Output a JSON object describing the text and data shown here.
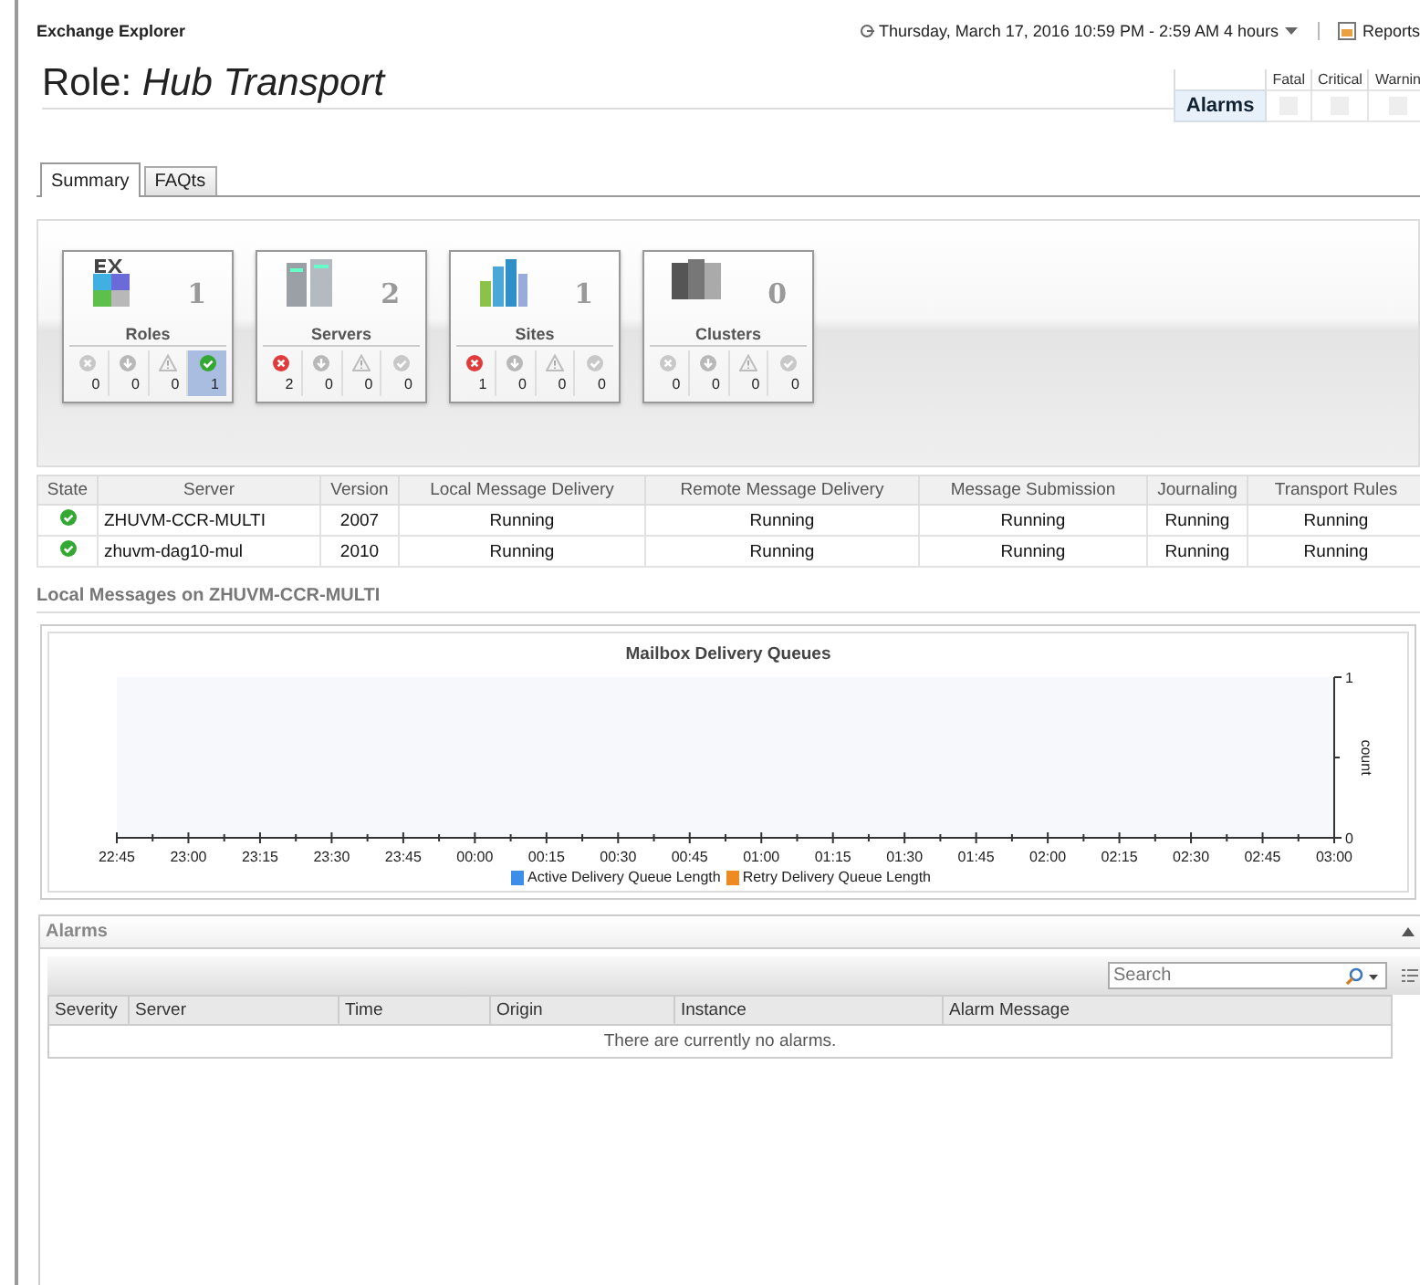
{
  "header": {
    "app_title": "Exchange Explorer",
    "time_range": "Thursday, March 17, 2016 10:59 PM - 2:59 AM 4 hours",
    "reports": "Reports"
  },
  "page_title": {
    "prefix": "Role:",
    "name": "Hub Transport"
  },
  "alarm_summary": {
    "row_label": "Alarms",
    "columns": [
      "Fatal",
      "Critical",
      "Warnin"
    ]
  },
  "tabs": [
    {
      "label": "Summary",
      "selected": true
    },
    {
      "label": "FAQts",
      "selected": false
    }
  ],
  "summary_cards": [
    {
      "kind": "roles",
      "label": "Roles",
      "count": "1",
      "statuses": [
        {
          "kind": "fatal",
          "count": "0",
          "active": false,
          "selected": false
        },
        {
          "kind": "critical",
          "count": "0",
          "active": false,
          "selected": false
        },
        {
          "kind": "warning",
          "count": "0",
          "active": false,
          "selected": false
        },
        {
          "kind": "normal",
          "count": "1",
          "active": true,
          "selected": true
        }
      ]
    },
    {
      "kind": "servers",
      "label": "Servers",
      "count": "2",
      "statuses": [
        {
          "kind": "fatal",
          "count": "2",
          "active": true,
          "selected": false
        },
        {
          "kind": "critical",
          "count": "0",
          "active": false,
          "selected": false
        },
        {
          "kind": "warning",
          "count": "0",
          "active": false,
          "selected": false
        },
        {
          "kind": "normal",
          "count": "0",
          "active": false,
          "selected": false
        }
      ]
    },
    {
      "kind": "sites",
      "label": "Sites",
      "count": "1",
      "statuses": [
        {
          "kind": "fatal",
          "count": "1",
          "active": true,
          "selected": false
        },
        {
          "kind": "critical",
          "count": "0",
          "active": false,
          "selected": false
        },
        {
          "kind": "warning",
          "count": "0",
          "active": false,
          "selected": false
        },
        {
          "kind": "normal",
          "count": "0",
          "active": false,
          "selected": false
        }
      ]
    },
    {
      "kind": "clusters",
      "label": "Clusters",
      "count": "0",
      "statuses": [
        {
          "kind": "fatal",
          "count": "0",
          "active": false,
          "selected": false
        },
        {
          "kind": "critical",
          "count": "0",
          "active": false,
          "selected": false
        },
        {
          "kind": "warning",
          "count": "0",
          "active": false,
          "selected": false
        },
        {
          "kind": "normal",
          "count": "0",
          "active": false,
          "selected": false
        }
      ]
    }
  ],
  "server_table": {
    "columns": [
      "State",
      "Server",
      "Version",
      "Local Message Delivery",
      "Remote Message Delivery",
      "Message Submission",
      "Journaling",
      "Transport Rules"
    ],
    "rows": [
      {
        "kind": "ok",
        "cells": [
          "",
          "ZHUVM-CCR-MULTI",
          "2007",
          "Running",
          "Running",
          "Running",
          "Running",
          "Running"
        ]
      },
      {
        "kind": "ok",
        "cells": [
          "",
          "zhuvm-dag10-mul",
          "2010",
          "Running",
          "Running",
          "Running",
          "Running",
          "Running"
        ]
      }
    ]
  },
  "local_messages": {
    "heading": "Local Messages on ZHUVM-CCR-MULTI",
    "chart_data": {
      "type": "line",
      "title": "Mailbox Delivery Queues",
      "ylabel": "count",
      "categories": [
        "22:45",
        "23:00",
        "23:15",
        "23:30",
        "23:45",
        "00:00",
        "00:15",
        "00:30",
        "00:45",
        "01:00",
        "01:15",
        "01:30",
        "01:45",
        "02:00",
        "02:15",
        "02:30",
        "02:45",
        "03:00"
      ],
      "ylim": [
        0,
        1
      ],
      "yticks": [
        0,
        1
      ],
      "series": [
        {
          "name": "Active Delivery Queue Length",
          "color": "#3d8ee8",
          "values": [
            null,
            null,
            null,
            null,
            null,
            null,
            null,
            null,
            null,
            null,
            null,
            null,
            null,
            null,
            null,
            null,
            null,
            null
          ]
        },
        {
          "name": "Retry Delivery Queue Length",
          "color": "#ee8a22",
          "values": [
            null,
            null,
            null,
            null,
            null,
            null,
            null,
            null,
            null,
            null,
            null,
            null,
            null,
            null,
            null,
            null,
            null,
            null
          ]
        }
      ]
    }
  },
  "alarms": {
    "title": "Alarms",
    "search": {
      "placeholder": "Search"
    },
    "columns": [
      "Severity",
      "Server",
      "Time",
      "Origin",
      "Instance",
      "Alarm Message"
    ],
    "empty_message": "There are currently no alarms."
  }
}
